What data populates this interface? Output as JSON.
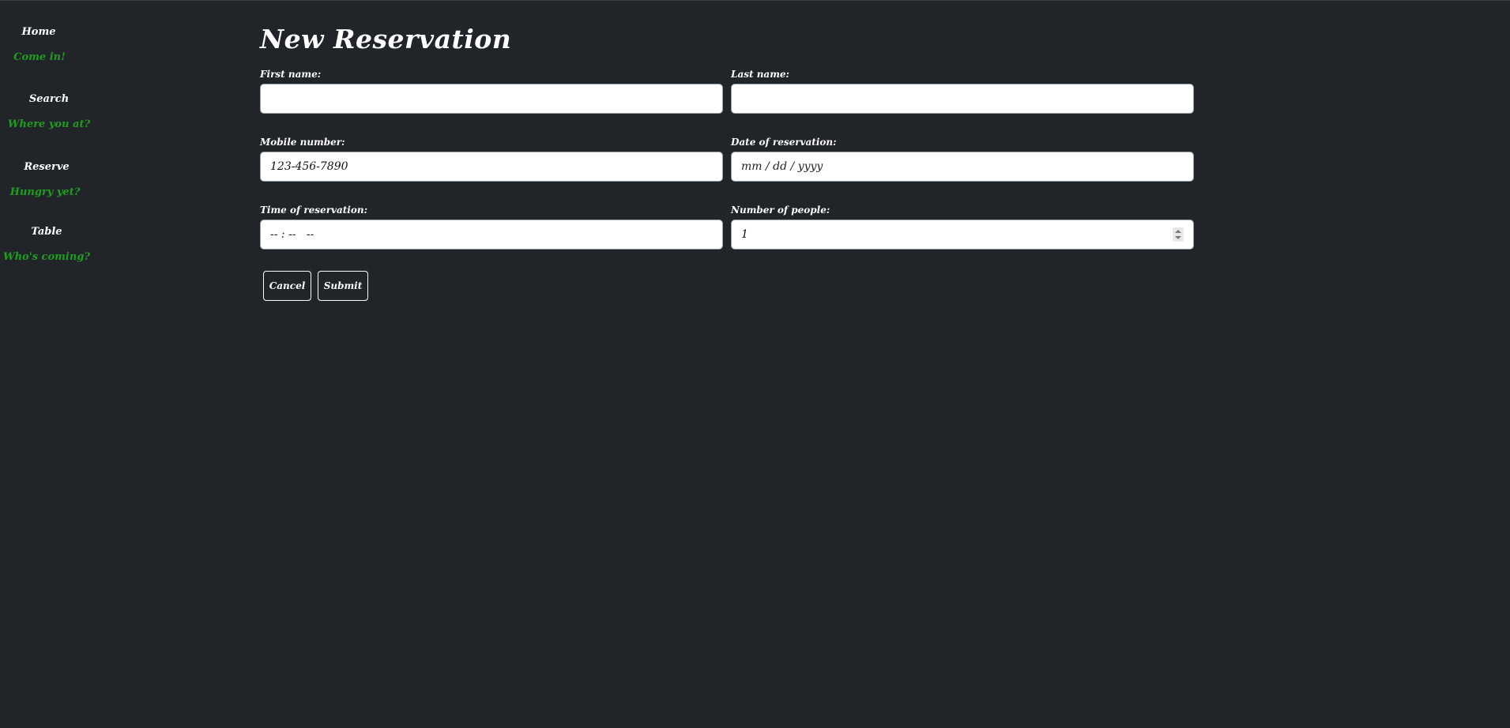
{
  "sidebar": {
    "items": [
      {
        "title": "Home",
        "subtitle": "Come in!"
      },
      {
        "title": "Search",
        "subtitle": "Where you at?"
      },
      {
        "title": "Reserve",
        "subtitle": "Hungry yet?"
      },
      {
        "title": "Table",
        "subtitle": "Who's coming?"
      }
    ]
  },
  "form": {
    "title": "New Reservation",
    "first_name": {
      "label": "First name:",
      "value": ""
    },
    "last_name": {
      "label": "Last name:",
      "value": ""
    },
    "mobile": {
      "label": "Mobile number:",
      "value": "123-456-7890"
    },
    "date": {
      "label": "Date of reservation:",
      "placeholder": "mm / dd / yyyy"
    },
    "time": {
      "label": "Time of reservation:",
      "placeholder": "-- : --   --"
    },
    "people": {
      "label": "Number of people:",
      "value": "1"
    },
    "cancel_label": "Cancel",
    "submit_label": "Submit"
  },
  "colors": {
    "background": "#212529",
    "accent_green": "#1e9e1e",
    "text": "#ffffff"
  }
}
